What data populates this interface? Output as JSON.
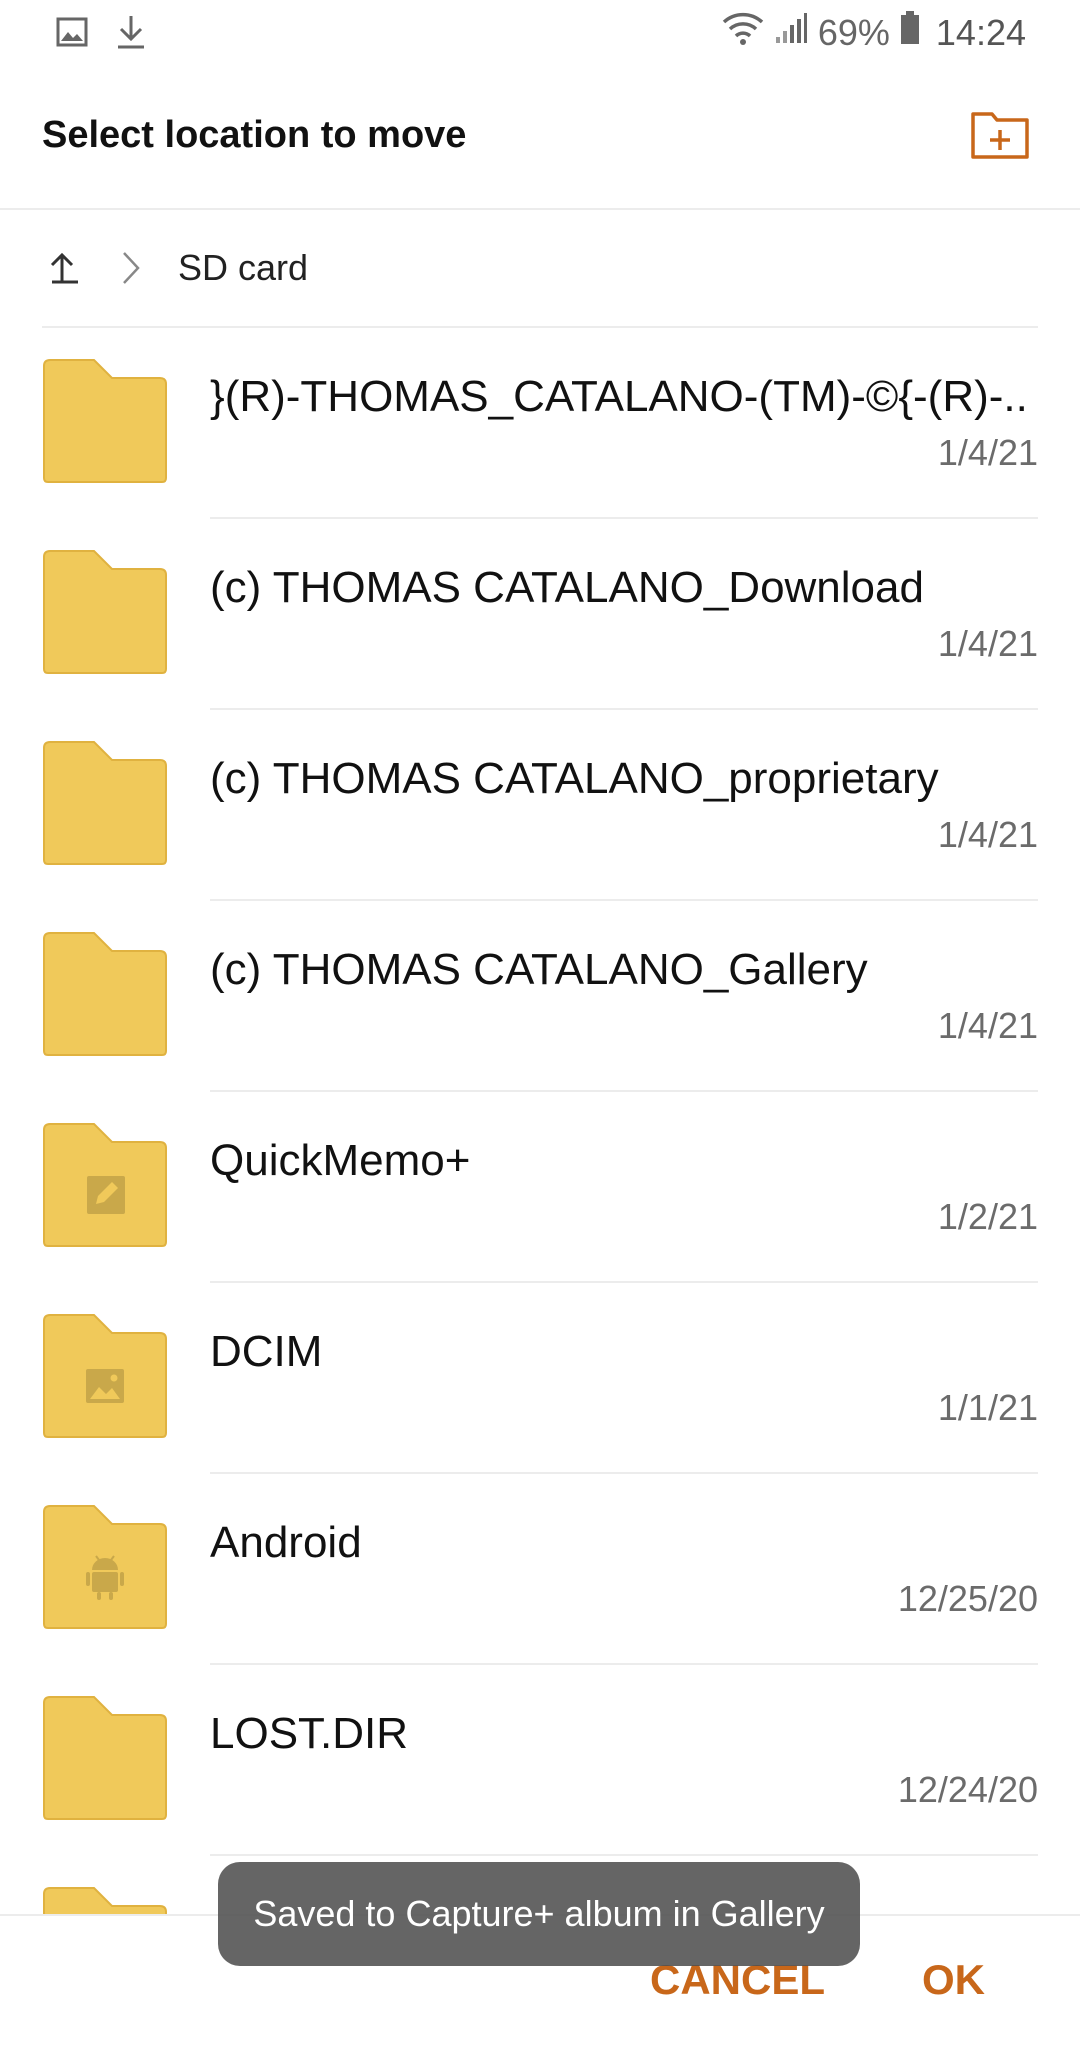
{
  "status_bar": {
    "battery": "69%",
    "time": "14:24",
    "icons": [
      "image-icon",
      "download-icon",
      "wifi-icon",
      "signal-icon",
      "battery-icon"
    ]
  },
  "header": {
    "title": "Select location to move",
    "new_folder_icon": "new-folder-icon"
  },
  "breadcrumb": {
    "up_icon": "up-arrow-icon",
    "location": "SD card"
  },
  "folders": [
    {
      "name": "}(R)-THOMAS_CATALANO-(TM)-©{-(R)-..",
      "date": "1/4/21",
      "icon": "folder-icon"
    },
    {
      "name": "(c) THOMAS CATALANO_Download",
      "date": "1/4/21",
      "icon": "folder-icon"
    },
    {
      "name": "(c) THOMAS CATALANO_proprietary",
      "date": "1/4/21",
      "icon": "folder-icon"
    },
    {
      "name": "(c) THOMAS CATALANO_Gallery",
      "date": "1/4/21",
      "icon": "folder-icon"
    },
    {
      "name": "QuickMemo+",
      "date": "1/2/21",
      "icon": "memo-folder-icon"
    },
    {
      "name": "DCIM",
      "date": "1/1/21",
      "icon": "image-folder-icon"
    },
    {
      "name": "Android",
      "date": "12/25/20",
      "icon": "android-folder-icon"
    },
    {
      "name": "LOST.DIR",
      "date": "12/24/20",
      "icon": "folder-icon"
    }
  ],
  "toast": {
    "message": "Saved to Capture+ album in Gallery"
  },
  "actions": {
    "cancel_label": "CANCEL",
    "ok_label": "OK"
  },
  "colors": {
    "accent": "#c8671a",
    "folder": "#f0c95a",
    "folder_edge": "#e0b240"
  }
}
